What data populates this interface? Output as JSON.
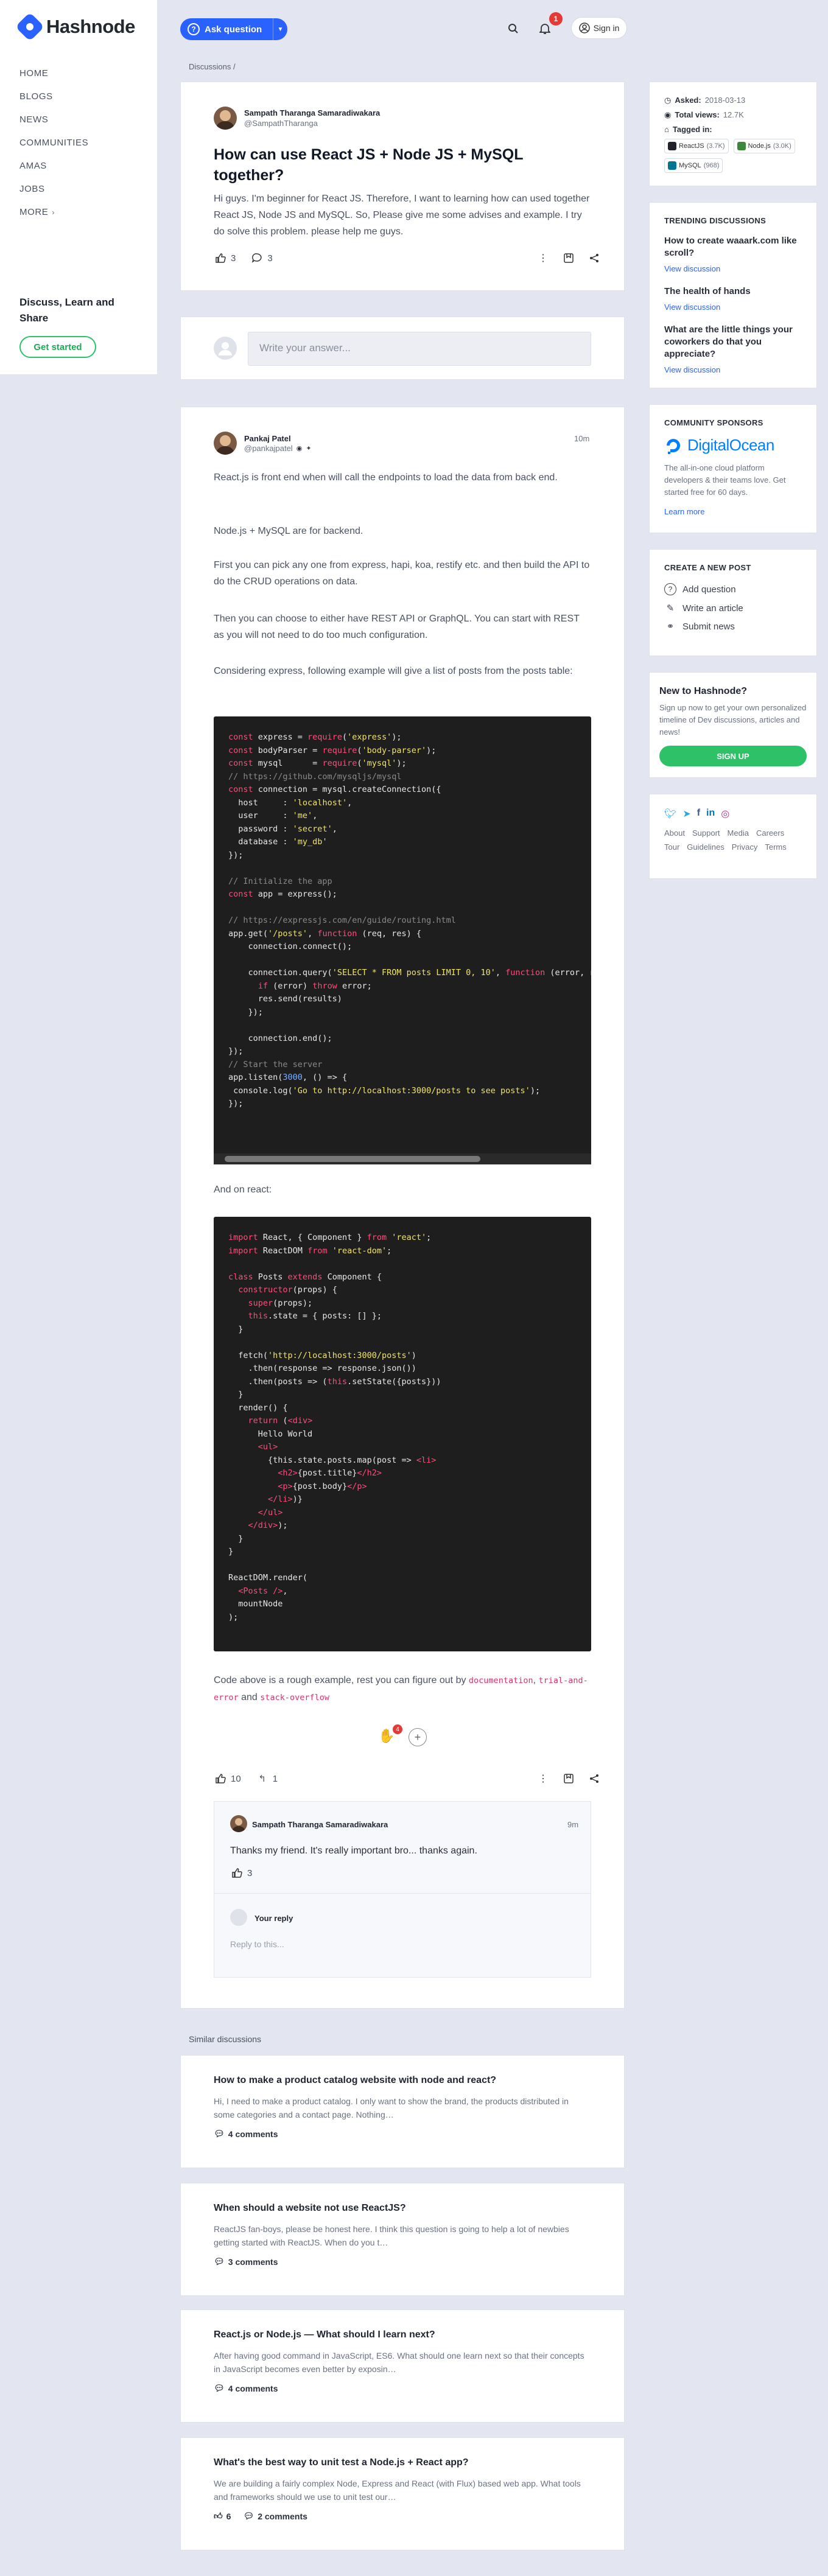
{
  "brand": {
    "name": "Hashnode",
    "color": "#2962ff"
  },
  "nav": {
    "items": [
      {
        "label": "HOME"
      },
      {
        "label": "BLOGS"
      },
      {
        "label": "NEWS"
      },
      {
        "label": "COMMUNITIES"
      },
      {
        "label": "AMAS"
      },
      {
        "label": "JOBS"
      },
      {
        "label": "MORE"
      }
    ]
  },
  "leftbar": {
    "tagline": "Discuss, Learn and Share",
    "cta": "Get started"
  },
  "topbar": {
    "ask_label": "Ask question",
    "notification_count": "1",
    "signin_label": "Sign in"
  },
  "breadcrumb": {
    "section": "Discussions",
    "sep": "/"
  },
  "question": {
    "author_name": "Sampath Tharanga Samaradiwakara",
    "author_handle": "@SampathTharanga",
    "title": "How can use React JS + Node JS + MySQL together?",
    "body": "Hi guys. I'm beginner for React JS. Therefore, I want to learning how can used together React JS, Node JS and MySQL. So, Please give me some advises and example. I try do solve this problem. please help me guys.",
    "likes": "3",
    "comments": "3"
  },
  "answer_box": {
    "placeholder": "Write your answer..."
  },
  "answer": {
    "author_name": "Pankaj Patel",
    "author_handle": "@pankajpatel",
    "time": "10m",
    "p1": "React.js is front end when will call the endpoints to load the data from back end.",
    "p2": "Node.js + MySQL are for backend.",
    "p3": "First you can pick any one from express, hapi, koa, restify etc. and then build the API to do the CRUD operations on data.",
    "p4": "Then you can choose to either have REST API or GraphQL. You can start with REST as you will not need to do too much configuration.",
    "p5": "Considering express, following example will give a list of posts from the posts table:",
    "p6": "And on react:",
    "p7_pre": "Code above is a rough example, rest you can figure out by",
    "link1": "documentation",
    "link2": "trial-and-error",
    "p7_and": "and",
    "link3": "stack-overflow",
    "reaction_count": "4",
    "likes": "10",
    "replies": "1"
  },
  "reply": {
    "author_name": "Sampath Tharanga Samaradiwakara",
    "time": "9m",
    "body": "Thanks my friend. It's really important bro... thanks again.",
    "likes": "3",
    "your_reply_label": "Your reply",
    "reply_placeholder": "Reply to this..."
  },
  "meta": {
    "asked_label": "Asked:",
    "asked_value": "2018-03-13",
    "views_label": "Total views:",
    "views_value": "12.7K",
    "tagged_label": "Tagged in:",
    "tags": [
      {
        "name": "ReactJS",
        "count": "(3.7K)",
        "color": "#20232a"
      },
      {
        "name": "Node.js",
        "count": "(3.0K)",
        "color": "#3c873a"
      },
      {
        "name": "MySQL",
        "count": "(968)",
        "color": "#00758f"
      }
    ]
  },
  "trending": {
    "heading": "TRENDING DISCUSSIONS",
    "view_label": "View discussion",
    "items": [
      {
        "title": "How to create waaark.com like scroll?"
      },
      {
        "title": "The health of hands"
      },
      {
        "title": "What are the little things your coworkers do that you appreciate?"
      }
    ]
  },
  "sponsor": {
    "heading": "COMMUNITY SPONSORS",
    "name": "DigitalOcean",
    "desc": "The all-in-one cloud platform developers & their teams love. Get started free for 60 days.",
    "link": "Learn more"
  },
  "create": {
    "heading": "CREATE A NEW POST",
    "items": [
      {
        "label": "Add question"
      },
      {
        "label": "Write an article"
      },
      {
        "label": "Submit news"
      }
    ]
  },
  "newto": {
    "heading": "New to Hashnode?",
    "desc": "Sign up now to get your own personalized timeline of Dev discussions, articles and news!",
    "button": "SIGN UP",
    "button_color": "#2ec268"
  },
  "footer": {
    "links": [
      "About",
      "Support",
      "Media",
      "Careers",
      "Tour",
      "Guidelines",
      "Privacy",
      "Terms"
    ]
  },
  "similar": {
    "heading": "Similar discussions",
    "items": [
      {
        "title": "How to make a product catalog website with node and react?",
        "body": "Hi, I need to make a product catalog. I only want to show the brand, the products distributed in some categories and a contact page. Nothing…",
        "meta": "4 comments"
      },
      {
        "title": "When should a website not use ReactJS?",
        "body": "ReactJS fan-boys, please be honest here. I think this question is going to help a lot of newbies getting started with ReactJS. When do you t…",
        "meta": "3 comments"
      },
      {
        "title": "React.js or Node.js — What should I learn next?",
        "body": "After having good command in JavaScript, ES6. What should one learn next so that their concepts in JavaScript becomes even better by exposin…",
        "meta": "4 comments"
      },
      {
        "title": "What's the best way to unit test a Node.js + React app?",
        "body": "We are building a fairly complex Node, Express and React (with Flux) based web app. What tools and frameworks should we use to unit test our…",
        "likes": "6",
        "meta": "2 comments"
      }
    ]
  }
}
